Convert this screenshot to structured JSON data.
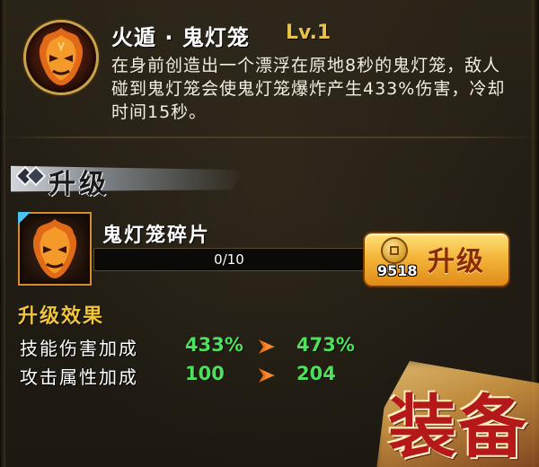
{
  "skill": {
    "title": "火遁 · 鬼灯笼",
    "level": "Lv.1",
    "description": "在身前创造出一个漂浮在原地8秒的鬼灯笼，敌人碰到鬼灯笼会使鬼灯笼爆炸产生433%伤害，冷却时间15秒。",
    "icon": "fire-mask-icon"
  },
  "upgrade_section": {
    "title": "升级"
  },
  "material": {
    "name": "鬼灯笼碎片",
    "progress_text": "0/10",
    "progress_fraction": 0.0,
    "icon": "fire-mask-fragment-icon"
  },
  "upgrade_button": {
    "label": "升级",
    "cost": "9518",
    "cost_icon": "copper-coin-icon"
  },
  "effects": {
    "title": "升级效果",
    "rows": [
      {
        "label": "技能伤害加成",
        "before": "433%",
        "after": "473%"
      },
      {
        "label": "攻击属性加成",
        "before": "100",
        "after": "204"
      }
    ]
  },
  "equip_button": {
    "label": "装备"
  },
  "colors": {
    "accent_gold": "#e8c14a",
    "value_green": "#4ee05a",
    "arrow_orange": "#f06a10",
    "item_border": "#d98a2a"
  }
}
